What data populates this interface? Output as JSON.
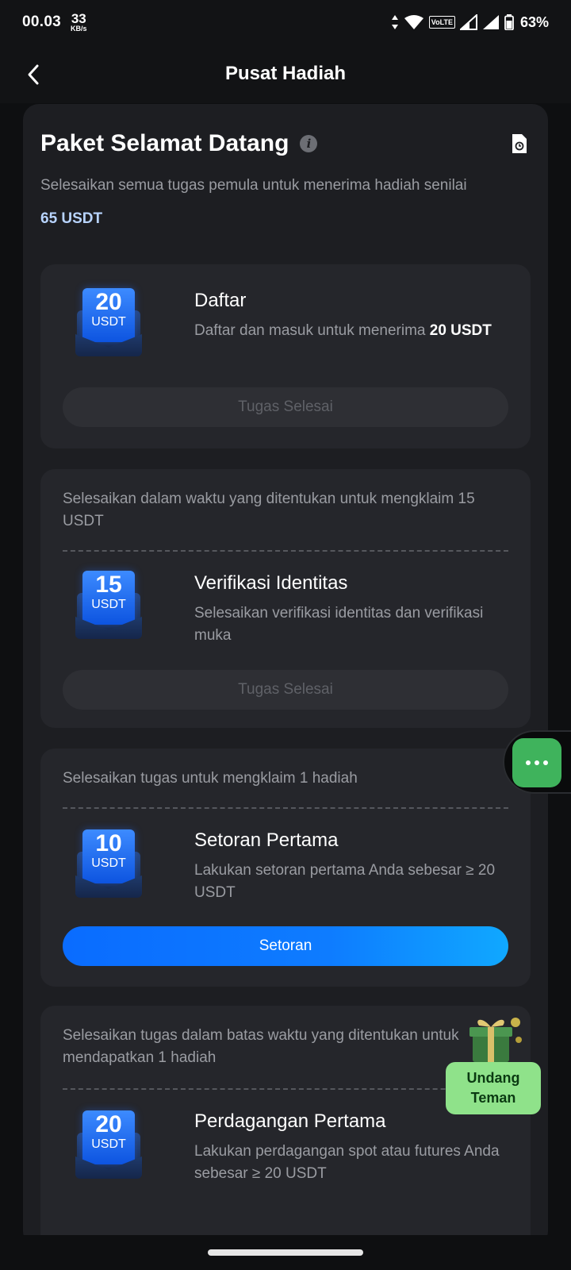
{
  "status_bar": {
    "time": "00.03",
    "speed_value": "33",
    "speed_unit": "KB/s",
    "volte": "VoLTE",
    "battery": "63%"
  },
  "header": {
    "title": "Pusat Hadiah"
  },
  "welcome": {
    "title": "Paket Selamat Datang",
    "description": "Selesaikan semua tugas pemula untuk menerima hadiah senilai",
    "amount": "65 USDT"
  },
  "tasks": [
    {
      "note": "",
      "badge_value": "20",
      "badge_unit": "USDT",
      "title": "Daftar",
      "desc_prefix": "Daftar dan masuk untuk menerima",
      "desc_bold": "20 USDT",
      "button": "Tugas Selesai"
    },
    {
      "note": "Selesaikan dalam waktu yang ditentukan untuk mengklaim 15 USDT",
      "badge_value": "15",
      "badge_unit": "USDT",
      "title": "Verifikasi Identitas",
      "desc": "Selesaikan verifikasi identitas dan verifikasi muka",
      "button": "Tugas Selesai"
    },
    {
      "note": "Selesaikan tugas untuk mengklaim 1 hadiah",
      "badge_value": "10",
      "badge_unit": "USDT",
      "title": "Setoran Pertama",
      "desc": "Lakukan setoran pertama Anda sebesar ≥ 20 USDT",
      "button": "Setoran"
    },
    {
      "note": "Selesaikan tugas dalam batas waktu yang ditentukan untuk mendapatkan 1 hadiah",
      "badge_value": "20",
      "badge_unit": "USDT",
      "title": "Perdagangan Pertama",
      "desc": "Lakukan perdagangan spot atau futures Anda sebesar ≥ 20 USDT"
    }
  ],
  "invite": {
    "label_line1": "Undang",
    "label_line2": "Teman"
  },
  "icons": {
    "back": "chevron-left-icon",
    "info": "info-icon",
    "history": "document-clock-icon",
    "chat": "chat-bubble-icon",
    "gift": "gift-box-icon"
  },
  "colors": {
    "accent_blue": "#0e7cff",
    "amount_blue": "#b8d4ff",
    "chat_green": "#3fb35c",
    "invite_green": "#8fe28a"
  }
}
